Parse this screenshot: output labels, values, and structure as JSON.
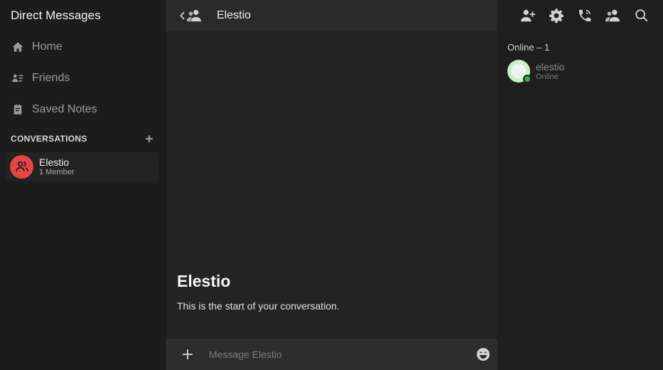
{
  "sidebar": {
    "title": "Direct Messages",
    "nav": [
      {
        "label": "Home",
        "icon": "home-icon"
      },
      {
        "label": "Friends",
        "icon": "friends-icon"
      },
      {
        "label": "Saved Notes",
        "icon": "notes-icon"
      }
    ],
    "section_title": "CONVERSATIONS",
    "conversations": [
      {
        "name": "Elestio",
        "subtitle": "1 Member",
        "avatar_color": "#e84444"
      }
    ]
  },
  "header": {
    "title": "Elestio",
    "actions": [
      "add-user-icon",
      "gear-icon",
      "phone-call-icon",
      "members-icon",
      "search-icon"
    ]
  },
  "chat": {
    "intro_title": "Elestio",
    "intro_text": "This is the start of your conversation."
  },
  "composer": {
    "placeholder": "Message Elestio"
  },
  "members": {
    "header": "Online – 1",
    "list": [
      {
        "name": "elestio",
        "status": "Online",
        "status_color": "#3ba55c"
      }
    ]
  },
  "colors": {
    "accent_red": "#e84444",
    "online_green": "#3ba55c"
  }
}
